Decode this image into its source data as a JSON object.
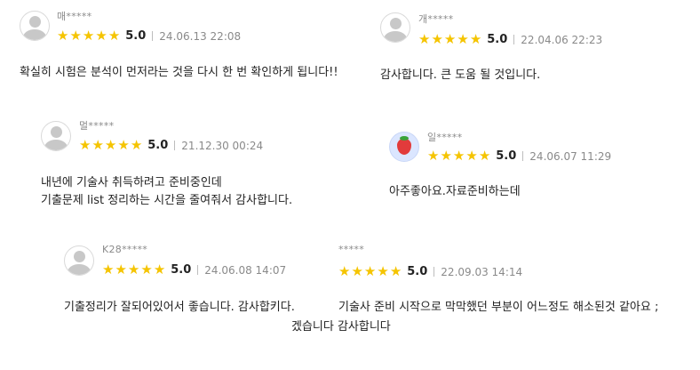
{
  "reviews": [
    {
      "author": "매*****",
      "rating": "5.0",
      "date": "24.06.13 22:08",
      "text": [
        "확실히 시험은 분석이 먼저라는 것을 다시 한 번 확인하게 됩니다!!"
      ]
    },
    {
      "author": "개*****",
      "rating": "5.0",
      "date": "22.04.06 22:23",
      "text": [
        "감사합니다. 큰 도움 될 것입니다."
      ]
    },
    {
      "author": "멀*****",
      "rating": "5.0",
      "date": "21.12.30 00:24",
      "text": [
        "내년에 기술사 취득하려고 준비중인데",
        "기출문제 list 정리하는 시간을 줄여줘서 감사합니다."
      ]
    },
    {
      "author": "일*****",
      "rating": "5.0",
      "date": "24.06.07 11:29",
      "text": [
        "아주좋아요.자료준비하는데"
      ]
    },
    {
      "author": "K28*****",
      "rating": "5.0",
      "date": "24.06.08 14:07",
      "text": [
        "기출정리가 잘되어있어서 좋습니다. 감사합키다."
      ]
    },
    {
      "author": "*****",
      "rating": "5.0",
      "date": "22.09.03 14:14",
      "text": [
        "기술사 준비 시작으로 막막했던 부분이 어느정도 해소된것 같아요 ;",
        "겠습니다 감사합니다"
      ]
    }
  ],
  "star_glyph": "★",
  "colors": {
    "star": "#f5c400",
    "meta": "#8a8a8a"
  }
}
